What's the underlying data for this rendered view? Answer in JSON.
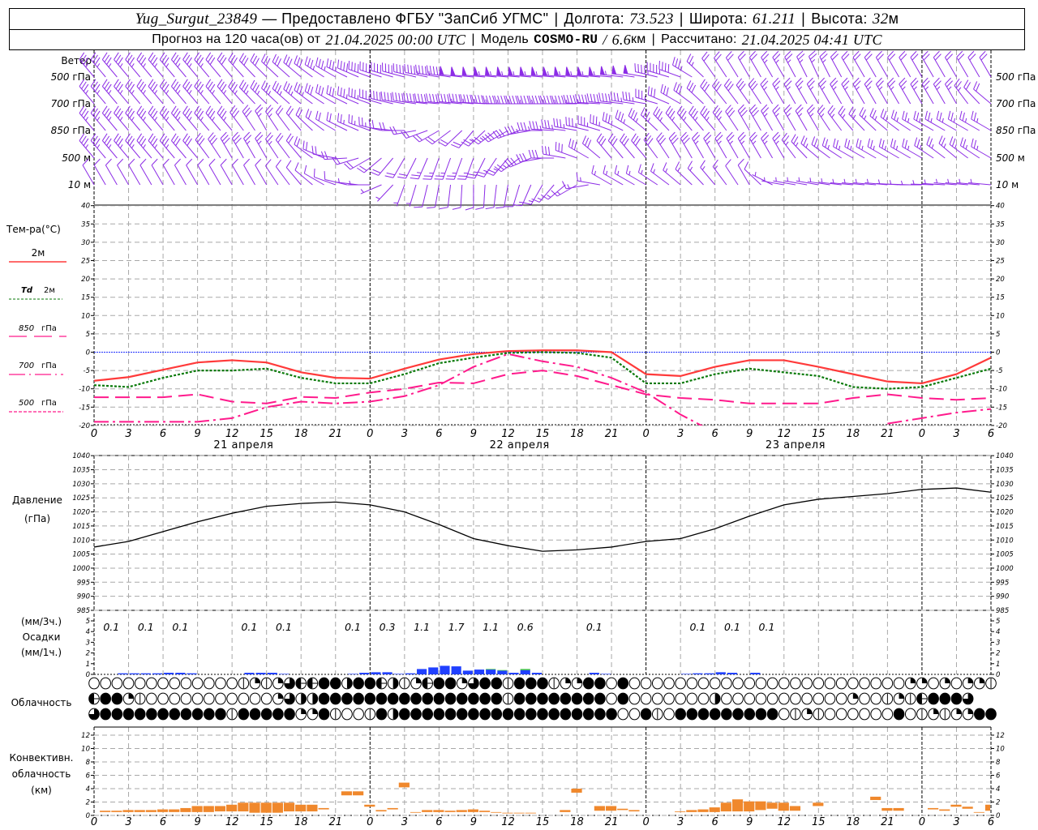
{
  "header": {
    "station": "Yug_Surgut_23849",
    "provider": "— Предоставлено ФГБУ \"ЗапСиб УГМС\"",
    "lon_label": "Долгота:",
    "lon": "73.523",
    "lat_label": "Широта:",
    "lat": "61.211",
    "alt_label": "Высота:",
    "alt": "32",
    "alt_unit": "м",
    "forecast_label": "Прогноз на 120 часа(ов) от",
    "forecast_start": "21.04.2025 00:00 UTC",
    "model_label": "Модель",
    "model": "COSMO-RU",
    "model_sep": "/",
    "resolution": "6.6",
    "res_unit": "км",
    "calc_label": "Рассчитано:",
    "calc_time": "21.04.2025 04:41 UTC",
    "separator": "|"
  },
  "colors": {
    "wind": "#8c2ce6",
    "t2m": "#ff3a3a",
    "td2m": "#0a7a0a",
    "upper": "#ff1a8c",
    "zero_line": "#2030ff",
    "precip": "#2040ff",
    "precip_other": "#2ec02e",
    "convective": "#f0882c"
  },
  "time_axis": {
    "hours": [
      "0",
      "3",
      "6",
      "9",
      "12",
      "15",
      "18",
      "21",
      "0",
      "3",
      "6",
      "9",
      "12",
      "15",
      "18",
      "21",
      "0",
      "3",
      "6",
      "9",
      "12",
      "15",
      "18",
      "21",
      "0",
      "3",
      "6"
    ],
    "dates": [
      {
        "label": "21 апреля",
        "hour": 13
      },
      {
        "label": "22 апреля",
        "hour": 37
      },
      {
        "label": "23 апреля",
        "hour": 61
      }
    ],
    "day_boundaries": [
      24,
      48,
      72
    ],
    "step_hours": 3
  },
  "wind": {
    "title": "Ветер",
    "levels": [
      {
        "value": "500",
        "unit": "гПа",
        "dir": [
          320,
          320,
          320,
          320,
          320,
          315,
          310,
          300,
          290,
          285,
          280,
          275,
          275,
          275,
          275,
          275,
          280,
          290,
          325,
          330,
          330,
          335,
          330,
          330,
          330,
          330,
          330
        ],
        "spd": [
          35,
          35,
          35,
          35,
          30,
          30,
          30,
          35,
          40,
          40,
          45,
          50,
          55,
          55,
          55,
          55,
          50,
          40,
          20,
          20,
          25,
          25,
          20,
          20,
          20,
          20,
          20
        ]
      },
      {
        "value": "700",
        "unit": "гПа",
        "dir": [
          320,
          320,
          320,
          320,
          320,
          315,
          310,
          300,
          290,
          280,
          275,
          275,
          270,
          270,
          270,
          275,
          280,
          300,
          320,
          325,
          330,
          330,
          330,
          330,
          330,
          330,
          310
        ],
        "spd": [
          35,
          35,
          35,
          35,
          35,
          35,
          35,
          30,
          35,
          40,
          40,
          45,
          45,
          45,
          45,
          40,
          35,
          30,
          30,
          30,
          25,
          25,
          25,
          25,
          25,
          25,
          20
        ]
      },
      {
        "value": "850",
        "unit": "гПа",
        "dir": [
          320,
          320,
          320,
          320,
          320,
          330,
          320,
          300,
          290,
          270,
          240,
          220,
          240,
          270,
          280,
          290,
          310,
          320,
          320,
          330,
          330,
          330,
          320,
          310,
          300,
          300,
          300
        ],
        "spd": [
          35,
          35,
          35,
          35,
          35,
          25,
          20,
          20,
          25,
          20,
          20,
          20,
          30,
          35,
          35,
          35,
          35,
          35,
          35,
          30,
          25,
          25,
          25,
          25,
          25,
          25,
          25
        ]
      },
      {
        "value": "500",
        "unit": "м",
        "dir": [
          320,
          320,
          320,
          320,
          330,
          330,
          320,
          280,
          240,
          210,
          200,
          200,
          220,
          260,
          290,
          320,
          320,
          330,
          330,
          330,
          330,
          310,
          300,
          300,
          300,
          310,
          300
        ],
        "spd": [
          35,
          35,
          35,
          30,
          30,
          25,
          20,
          20,
          20,
          20,
          25,
          25,
          25,
          30,
          30,
          30,
          30,
          30,
          25,
          25,
          25,
          25,
          25,
          25,
          25,
          25,
          25
        ]
      },
      {
        "value": "10",
        "unit": "м",
        "dir": [
          330,
          330,
          330,
          330,
          330,
          330,
          320,
          290,
          270,
          200,
          190,
          180,
          190,
          210,
          240,
          300,
          300,
          310,
          320,
          330,
          280,
          280,
          275,
          275,
          270,
          275,
          275
        ],
        "spd": [
          10,
          10,
          10,
          10,
          10,
          10,
          10,
          10,
          5,
          5,
          10,
          10,
          10,
          15,
          15,
          15,
          15,
          15,
          15,
          10,
          5,
          5,
          5,
          5,
          5,
          5,
          5
        ]
      }
    ]
  },
  "temperature": {
    "title": "Тем-ра(°С)",
    "yticks": [
      "40",
      "35",
      "30",
      "25",
      "20",
      "15",
      "10",
      "5",
      "0",
      "-5",
      "-10",
      "-15",
      "-20"
    ],
    "ylim": [
      -20,
      40
    ],
    "legend": {
      "t2m": "2м",
      "td_sym": "Td",
      "td_lvl": "2м",
      "l850": "850",
      "l700": "700",
      "l500": "500",
      "unit": "гПа"
    },
    "series": {
      "t2m": [
        -7.8,
        -6.8,
        -4.8,
        -2.8,
        -2.2,
        -2.8,
        -5.5,
        -7,
        -7.2,
        -4.5,
        -2,
        -0.5,
        0.3,
        0.5,
        0.5,
        0,
        -6,
        -6.5,
        -4,
        -2.2,
        -2.2,
        -4,
        -6,
        -8,
        -8.5,
        -6,
        -1.5
      ],
      "td2m": [
        -9,
        -9.5,
        -7,
        -5,
        -5,
        -4.5,
        -7,
        -8.5,
        -8.5,
        -6,
        -3,
        -1.5,
        -0.2,
        0,
        -0.2,
        -1.5,
        -8.5,
        -8.5,
        -6,
        -4.5,
        -5.5,
        -6.5,
        -9.5,
        -10,
        -9.5,
        -7,
        -4.5
      ],
      "t850": [
        -12.3,
        -12.3,
        -12.3,
        -11.5,
        -13.5,
        -14,
        -12.2,
        -12.5,
        -11,
        -10,
        -8.3,
        -8.5,
        -6,
        -5,
        -6.5,
        -9,
        -11.5,
        -12.5,
        -13,
        -14,
        -14,
        -14,
        -12.5,
        -11.5,
        -12.5,
        -13,
        -12.5
      ],
      "t700": [
        -19,
        -19,
        -19,
        -19,
        -18,
        -15,
        -13.5,
        -14,
        -13.5,
        -12,
        -9,
        -4,
        -0.5,
        -2.5,
        -4,
        -7,
        -11,
        -17,
        -22,
        null,
        null,
        null,
        null,
        -19.5,
        -18,
        -16.5,
        -15.5
      ]
    }
  },
  "pressure": {
    "title": "Давление",
    "unit": "(гПа)",
    "yticks": [
      "1040",
      "1035",
      "1030",
      "1025",
      "1020",
      "1015",
      "1010",
      "1005",
      "1000",
      "995",
      "990",
      "985"
    ],
    "ylim": [
      985,
      1040
    ],
    "values": [
      1007.5,
      1009.5,
      1013,
      1016.5,
      1019.5,
      1022,
      1023,
      1023.5,
      1022.5,
      1020,
      1015.5,
      1010.5,
      1008,
      1006,
      1006.5,
      1007.5,
      1009.5,
      1010.5,
      1014,
      1018.5,
      1022.5,
      1024.5,
      1025.5,
      1026.5,
      1028,
      1028.5,
      1027
    ]
  },
  "precipitation": {
    "label_3h": "(мм/3ч.)",
    "title": "Осадки",
    "label_1h": "(мм/1ч.)",
    "yticks": [
      "5",
      "4",
      "3",
      "2",
      "1",
      "0"
    ],
    "totals_3h": [
      {
        "period": 0,
        "value": "0.1"
      },
      {
        "period": 1,
        "value": "0.1"
      },
      {
        "period": 2,
        "value": "0.1"
      },
      {
        "period": 4,
        "value": "0.1"
      },
      {
        "period": 5,
        "value": "0.1"
      },
      {
        "period": 7,
        "value": "0.1"
      },
      {
        "period": 8,
        "value": "0.3"
      },
      {
        "period": 9,
        "value": "1.1"
      },
      {
        "period": 10,
        "value": "1.7"
      },
      {
        "period": 11,
        "value": "1.1"
      },
      {
        "period": 12,
        "value": "0.6"
      },
      {
        "period": 14,
        "value": "0.1"
      },
      {
        "period": 17,
        "value": "0.1"
      },
      {
        "period": 18,
        "value": "0.1"
      },
      {
        "period": 19,
        "value": "0.1"
      }
    ],
    "hourly": [
      [
        3,
        0.1,
        0
      ],
      [
        4,
        0.1,
        0
      ],
      [
        5,
        0.1,
        0
      ],
      [
        6,
        0.1,
        0
      ],
      [
        7,
        0.15,
        0
      ],
      [
        8,
        0.15,
        0
      ],
      [
        9,
        0.1,
        0
      ],
      [
        14,
        0.15,
        0
      ],
      [
        15,
        0.15,
        0
      ],
      [
        16,
        0.15,
        0
      ],
      [
        17,
        0.05,
        0
      ],
      [
        23,
        0.05,
        0
      ],
      [
        24,
        0.15,
        0
      ],
      [
        25,
        0.2,
        0
      ],
      [
        26,
        0.2,
        0
      ],
      [
        27,
        0.05,
        0
      ],
      [
        28,
        0.1,
        0
      ],
      [
        29,
        0.5,
        0
      ],
      [
        30,
        0.65,
        0
      ],
      [
        31,
        0.8,
        0
      ],
      [
        32,
        0.75,
        0
      ],
      [
        33,
        0.35,
        0
      ],
      [
        34,
        0.45,
        0
      ],
      [
        35,
        0.45,
        0.05
      ],
      [
        36,
        0.35,
        0.05
      ],
      [
        37,
        0.15,
        0
      ],
      [
        38,
        0.4,
        0.1
      ],
      [
        39,
        0.15,
        0
      ],
      [
        44,
        0.15,
        0
      ],
      [
        45,
        0.05,
        0
      ],
      [
        52,
        0.05,
        0
      ],
      [
        53,
        0.1,
        0
      ],
      [
        54,
        0.1,
        0
      ],
      [
        55,
        0.2,
        0
      ],
      [
        56,
        0.15,
        0
      ],
      [
        58,
        0.15,
        0
      ]
    ]
  },
  "cloudiness": {
    "title": "Облачность",
    "legend_codes": {
      "0": "clear",
      "v": "few",
      "1": "quarter",
      "2": "half",
      "3": "three-quarter",
      "4": "overcast",
      "h": "half-fog"
    },
    "rows": [
      "0000000000000v1v13hh44244h2v1h441344v444v1144040000000000000000000000001101011v",
      "h441v0000000000013224444444444444444v44444444040000000200000000000100v1vh4443",
      "344444444444v44444114v00v424444444444444444444004v04444444440v1v00000040v1v1144"
    ]
  },
  "convective": {
    "title1": "Конвективн.",
    "title2": "облачность",
    "unit": "(км)",
    "yticks": [
      "12",
      "10",
      "8",
      "6",
      "4",
      "2",
      "0"
    ],
    "ylim": [
      0,
      13
    ],
    "bars": [
      [
        1,
        0.5,
        0.7
      ],
      [
        2,
        0.5,
        0.7
      ],
      [
        3,
        0.5,
        0.8
      ],
      [
        4,
        0.5,
        0.8
      ],
      [
        5,
        0.5,
        0.8
      ],
      [
        6,
        0.5,
        0.9
      ],
      [
        7,
        0.5,
        0.9
      ],
      [
        8,
        0.5,
        1.1
      ],
      [
        9,
        0.5,
        1.4
      ],
      [
        10,
        0.5,
        1.4
      ],
      [
        11,
        0.6,
        1.4
      ],
      [
        12,
        0.6,
        1.6
      ],
      [
        13,
        0.6,
        1.9
      ],
      [
        14,
        0.4,
        1.9
      ],
      [
        15,
        0.4,
        1.9
      ],
      [
        16,
        0.4,
        1.9
      ],
      [
        17,
        0.6,
        1.9
      ],
      [
        18,
        0.6,
        1.6
      ],
      [
        19,
        0.6,
        1.6
      ],
      [
        20,
        0.9,
        1.1
      ],
      [
        22,
        3.0,
        3.6
      ],
      [
        23,
        3.0,
        3.6
      ],
      [
        24,
        1.3,
        1.6
      ],
      [
        25,
        0.6,
        0.8
      ],
      [
        26,
        0.9,
        1.1
      ],
      [
        27,
        4.2,
        4.9
      ],
      [
        28,
        0.4,
        0.5
      ],
      [
        29,
        0.5,
        0.8
      ],
      [
        30,
        0.5,
        0.8
      ],
      [
        31,
        0.5,
        0.7
      ],
      [
        32,
        0.5,
        0.8
      ],
      [
        33,
        0.5,
        0.9
      ],
      [
        34,
        0.5,
        0.7
      ],
      [
        35,
        0.4,
        0.5
      ],
      [
        36,
        0.3,
        0.4
      ],
      [
        37,
        0.3,
        0.4
      ],
      [
        38,
        0.3,
        0.4
      ],
      [
        41,
        0.5,
        0.8
      ],
      [
        42,
        3.4,
        4.0
      ],
      [
        44,
        0.7,
        1.4
      ],
      [
        45,
        0.7,
        1.4
      ],
      [
        46,
        0.8,
        1.0
      ],
      [
        47,
        0.6,
        0.8
      ],
      [
        51,
        0.5,
        0.6
      ],
      [
        52,
        0.5,
        0.8
      ],
      [
        53,
        0.5,
        0.9
      ],
      [
        54,
        0.5,
        1.2
      ],
      [
        55,
        0.6,
        1.9
      ],
      [
        56,
        0.6,
        2.4
      ],
      [
        57,
        0.6,
        2.1
      ],
      [
        58,
        0.8,
        2.1
      ],
      [
        59,
        1.0,
        1.9
      ],
      [
        60,
        0.7,
        1.9
      ],
      [
        61,
        0.7,
        1.4
      ],
      [
        63,
        1.4,
        1.9
      ],
      [
        68,
        2.3,
        2.8
      ],
      [
        69,
        0.7,
        1.1
      ],
      [
        70,
        0.7,
        1.1
      ],
      [
        73,
        0.9,
        1.1
      ],
      [
        74,
        0.7,
        0.9
      ],
      [
        75,
        1.3,
        1.6
      ],
      [
        76,
        1.0,
        1.3
      ],
      [
        77,
        0.4,
        0.5
      ],
      [
        78,
        0.7,
        1.6
      ]
    ]
  }
}
